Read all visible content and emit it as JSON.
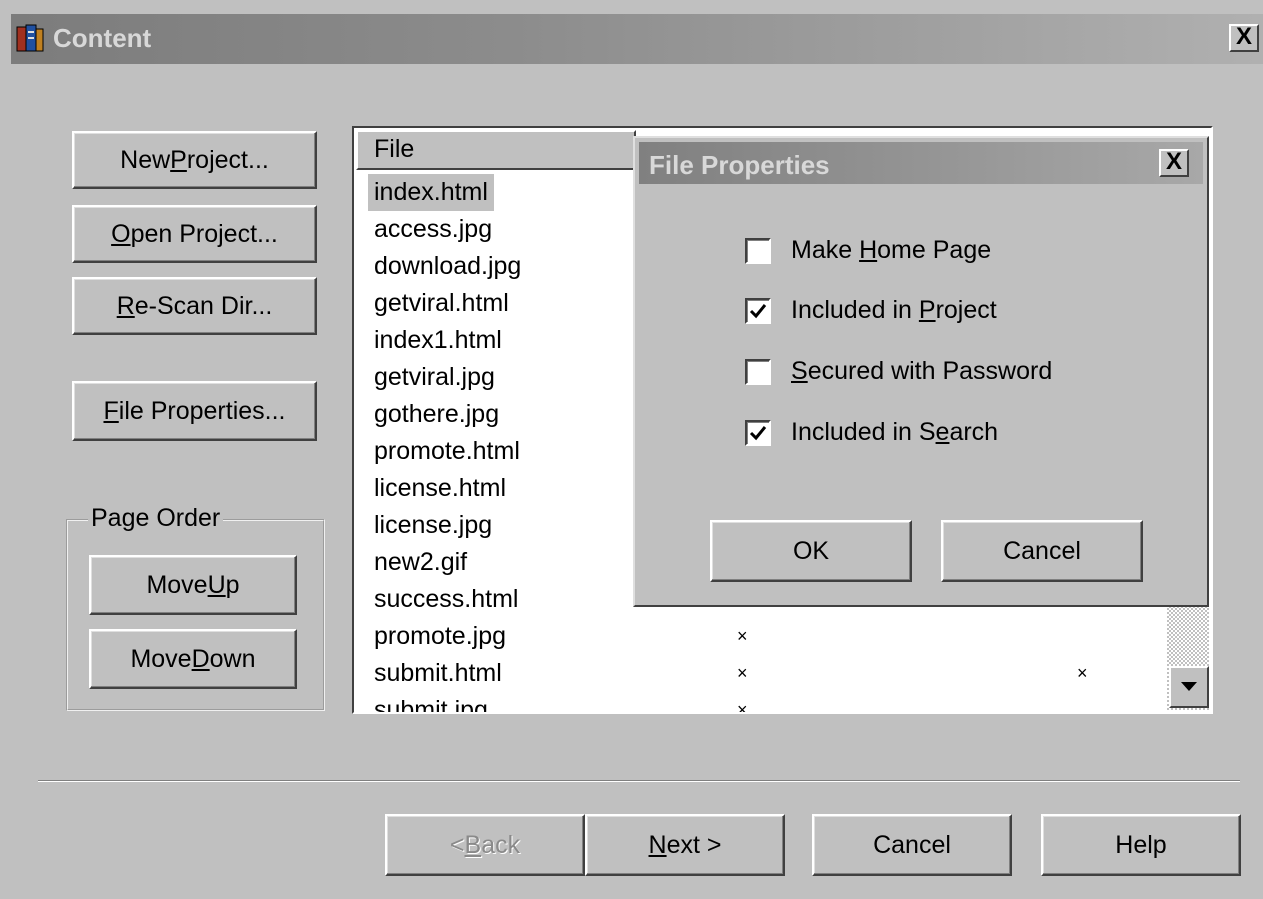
{
  "window": {
    "title": "Content",
    "close_label": "X"
  },
  "left_buttons": {
    "new_project": {
      "pre": "New ",
      "key": "P",
      "post": "roject..."
    },
    "open_project": {
      "pre": "",
      "key": "O",
      "post": "pen Project..."
    },
    "rescan_dir": {
      "pre": "",
      "key": "R",
      "post": "e-Scan Dir..."
    },
    "file_properties": {
      "pre": "",
      "key": "F",
      "post": "ile Properties..."
    }
  },
  "page_order": {
    "legend": "Page Order",
    "move_up": {
      "pre": "Move ",
      "key": "U",
      "post": "p"
    },
    "move_down": {
      "pre": "Move ",
      "key": "D",
      "post": "own"
    }
  },
  "file_list": {
    "header": "File",
    "rows": [
      "index.html",
      "access.jpg",
      "download.jpg",
      "getviral.html",
      "index1.html",
      "getviral.jpg",
      "gothere.jpg",
      "promote.html",
      "license.html",
      "license.jpg",
      "new2.gif",
      "success.html",
      "promote.jpg",
      "submit.html",
      "submit.jpg"
    ],
    "marks": [
      "×",
      "×",
      "×",
      "×"
    ]
  },
  "dialog": {
    "title": "File Properties",
    "close_label": "X",
    "options": [
      {
        "pre": "Make ",
        "key": "H",
        "post": "ome Page",
        "checked": false
      },
      {
        "pre": "Included in ",
        "key": "P",
        "post": "roject",
        "checked": true
      },
      {
        "pre": "",
        "key": "S",
        "post": "ecured with Password",
        "checked": false
      },
      {
        "pre": "Included in S",
        "key": "e",
        "post": "arch",
        "checked": true
      }
    ],
    "ok_label": "OK",
    "cancel_label": "Cancel"
  },
  "footer": {
    "back": {
      "pre": "< ",
      "key": "B",
      "post": "ack"
    },
    "next": {
      "pre": "",
      "key": "N",
      "post": "ext >"
    },
    "cancel": "Cancel",
    "help": "Help"
  },
  "icons": {
    "app": "book-icon",
    "check": "checkmark-icon",
    "scroll_down": "down-arrow-icon"
  }
}
